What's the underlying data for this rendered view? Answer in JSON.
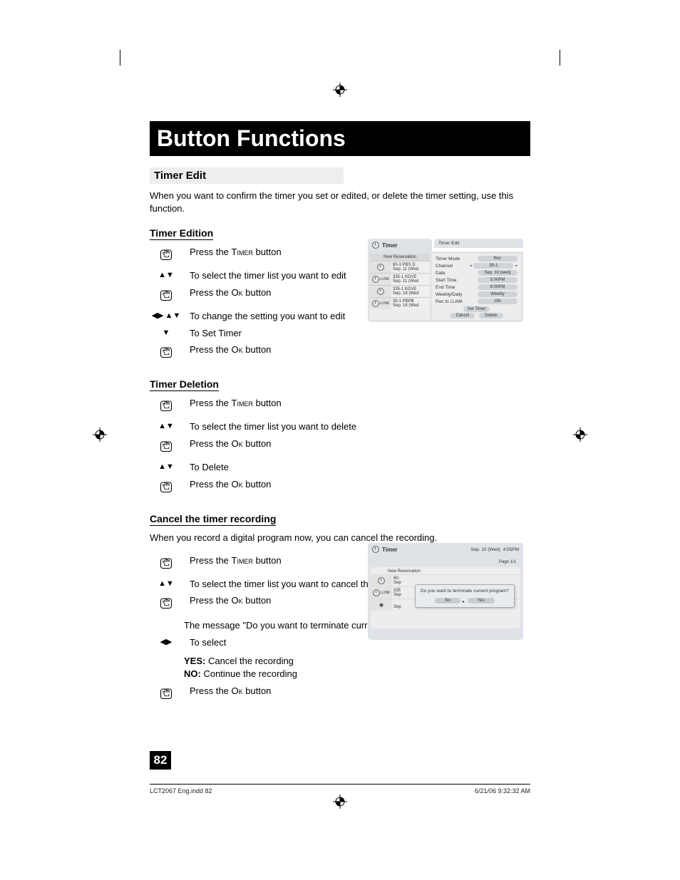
{
  "title": "Button Functions",
  "section_timer_edit": {
    "heading": "Timer Edit",
    "intro": "When you want to confirm the timer you set or edited, or delete the timer setting, use this function."
  },
  "timer_edition": {
    "heading": "Timer Edition",
    "steps": [
      {
        "icon": "hand",
        "text_before": "Press the ",
        "sc": "Timer",
        "text_after": " button"
      },
      {
        "icon": "updown",
        "text": "To select the timer list you want to edit"
      },
      {
        "icon": "hand",
        "text_before": "Press the ",
        "sc": "Ok",
        "text_after": " button"
      },
      {
        "icon": "lr_updown",
        "text": "To change the setting you want to edit"
      },
      {
        "icon": "down",
        "text": "To Set Timer"
      },
      {
        "icon": "hand",
        "text_before": "Press the ",
        "sc": "Ok",
        "text_after": " button"
      }
    ]
  },
  "timer_deletion": {
    "heading": "Timer Deletion",
    "steps": [
      {
        "icon": "hand",
        "text_before": "Press the ",
        "sc": "Timer",
        "text_after": " button"
      },
      {
        "icon": "updown",
        "text": "To select the timer list you want to delete"
      },
      {
        "icon": "hand",
        "text_before": "Press the ",
        "sc": "Ok",
        "text_after": " button"
      },
      {
        "icon": "updown",
        "text": "To Delete"
      },
      {
        "icon": "hand",
        "text_before": "Press the ",
        "sc": "Ok",
        "text_after": " button"
      }
    ]
  },
  "cancel": {
    "heading": "Cancel the timer recording",
    "intro": "When you record a digital program now, you can cancel the recording.",
    "steps": [
      {
        "icon": "hand",
        "text_before": "Press the ",
        "sc": "Timer",
        "text_after": " button"
      },
      {
        "icon": "updown",
        "text": "To select the timer list you want to cancel the recording"
      },
      {
        "icon": "hand",
        "text_before": "Press the ",
        "sc": "Ok",
        "text_after": " button",
        "msg": "The message \"Do you want to terminate current program ?\" will appear."
      },
      {
        "icon": "lr",
        "text": "To select",
        "opts": [
          {
            "label": "YES:",
            "desc": "Cancel the recording"
          },
          {
            "label": "NO:",
            "desc": "Continue the recording"
          }
        ]
      },
      {
        "icon": "hand",
        "text_before": "Press the ",
        "sc": "Ok",
        "text_after": " button"
      }
    ]
  },
  "osd1": {
    "title": "Timer",
    "right_title": "Timer Edit",
    "new_reservation": "New Reservation",
    "list": [
      {
        "badge": "clock",
        "line1": "80-3  PBS D",
        "line2": "Sep. 11 (Wed"
      },
      {
        "badge": "ilink",
        "line1": "335-1  KDVE",
        "line2": "Sep. 11 (Wed"
      },
      {
        "badge": "clock",
        "line1": "335-1  KDVE",
        "line2": "Sep. 18 (Wed"
      },
      {
        "badge": "ilink",
        "line1": "35-1  PBPB",
        "line2": "Sep. 18 (Wed"
      }
    ],
    "props": [
      {
        "label": "Timer Mode",
        "value": "Rec"
      },
      {
        "label": "Channel",
        "value": "35-1",
        "arrows": true
      },
      {
        "label": "Date",
        "value": "Sep. 10 (wed)"
      },
      {
        "label": "Start Time",
        "value": "5:00PM"
      },
      {
        "label": "End Time",
        "value": "6:00PM"
      },
      {
        "label": "Weekly/Daily",
        "value": "Weekly"
      },
      {
        "label": "Rec to i.LINK",
        "value": "ON"
      }
    ],
    "set_timer": "Set Timer",
    "cancel_btn": "Cancel",
    "delete_btn": "Delete"
  },
  "osd2": {
    "title": "Timer",
    "date": "Sep. 10 (Wed)",
    "time": "4:55PM",
    "page": "Page 1/1",
    "new_reservation": "New Reservation",
    "list": [
      {
        "badge": "clock",
        "c": "80-"
      },
      {
        "badge": "ilink",
        "c": "335"
      },
      {
        "badge": "play",
        "c": ""
      }
    ],
    "dialog_text": "Do you want to terminate current program?",
    "no": "No",
    "yes": "Yes"
  },
  "page_number": "82",
  "footer_left": "LCT2067 Eng.indd   82",
  "footer_right": "6/21/06   9:32:32 AM"
}
